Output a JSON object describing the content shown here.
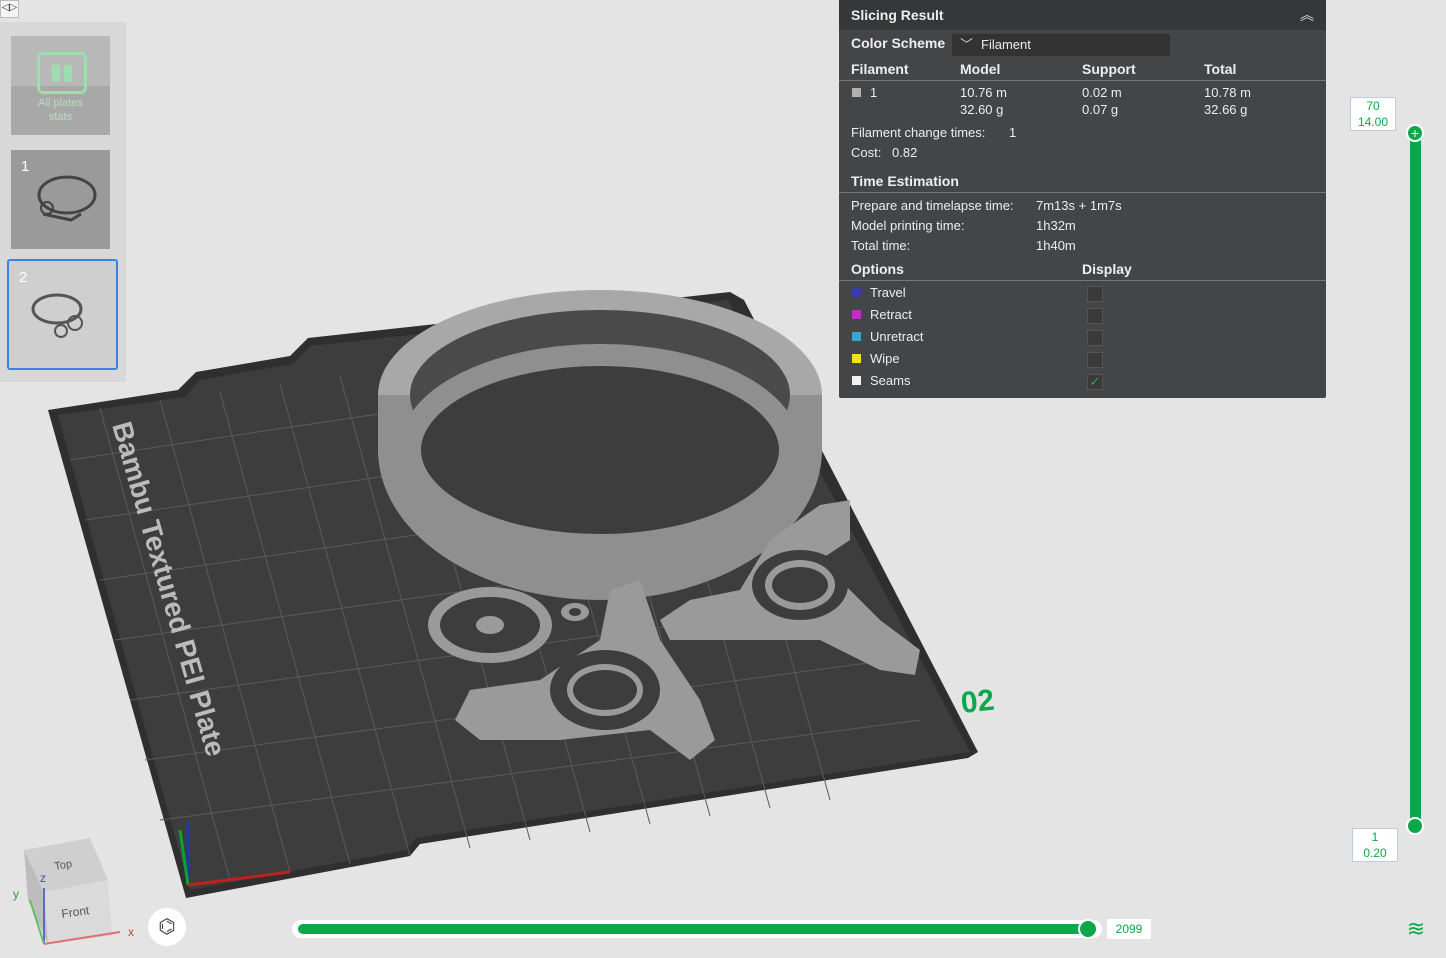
{
  "toggle": {
    "label": "◁▷"
  },
  "plates": {
    "all": {
      "label_line1": "All plates",
      "label_line2": "stats"
    },
    "items": [
      {
        "number": "1"
      },
      {
        "number": "2"
      }
    ]
  },
  "plate_label": "02",
  "bed_text": "Bambu Textured PEI Plate",
  "slicing": {
    "title": "Slicing Result",
    "color_scheme_label": "Color Scheme",
    "color_scheme_value": "Filament",
    "columns": [
      "Filament",
      "Model",
      "Support",
      "Total"
    ],
    "filament_row": {
      "id": "1",
      "model_len": "10.76 m",
      "model_wt": "32.60 g",
      "support_len": "0.02 m",
      "support_wt": "0.07 g",
      "total_len": "10.78 m",
      "total_wt": "32.66 g"
    },
    "change_times_label": "Filament change times:",
    "change_times_value": "1",
    "cost_label": "Cost:",
    "cost_value": "0.82",
    "time_title": "Time Estimation",
    "prepare_label": "Prepare and timelapse time:",
    "prepare_value": "7m13s + 1m7s",
    "model_time_label": "Model printing time:",
    "model_time_value": "1h32m",
    "total_time_label": "Total time:",
    "total_time_value": "1h40m",
    "options_title": "Options",
    "display_title": "Display",
    "options": [
      {
        "label": "Travel",
        "color": "#3c3ca8",
        "checked": false
      },
      {
        "label": "Retract",
        "color": "#c030c0",
        "checked": false
      },
      {
        "label": "Unretract",
        "color": "#40a0d0",
        "checked": false
      },
      {
        "label": "Wipe",
        "color": "#f0e020",
        "checked": false
      },
      {
        "label": "Seams",
        "color": "#f0f0f0",
        "checked": true
      }
    ]
  },
  "layer_slider": {
    "top_layer": "70",
    "top_height": "14.00",
    "bottom_layer": "1",
    "bottom_height": "0.20"
  },
  "move_slider": {
    "value": "2099"
  },
  "view_cube": {
    "top": "Top",
    "front": "Front",
    "x": "x",
    "y": "y",
    "z": "z"
  },
  "colors": {
    "accent": "#0aa84a",
    "panel_bg": "#444547",
    "bed": "#3a3a3a",
    "model": "#9a9a9a"
  }
}
